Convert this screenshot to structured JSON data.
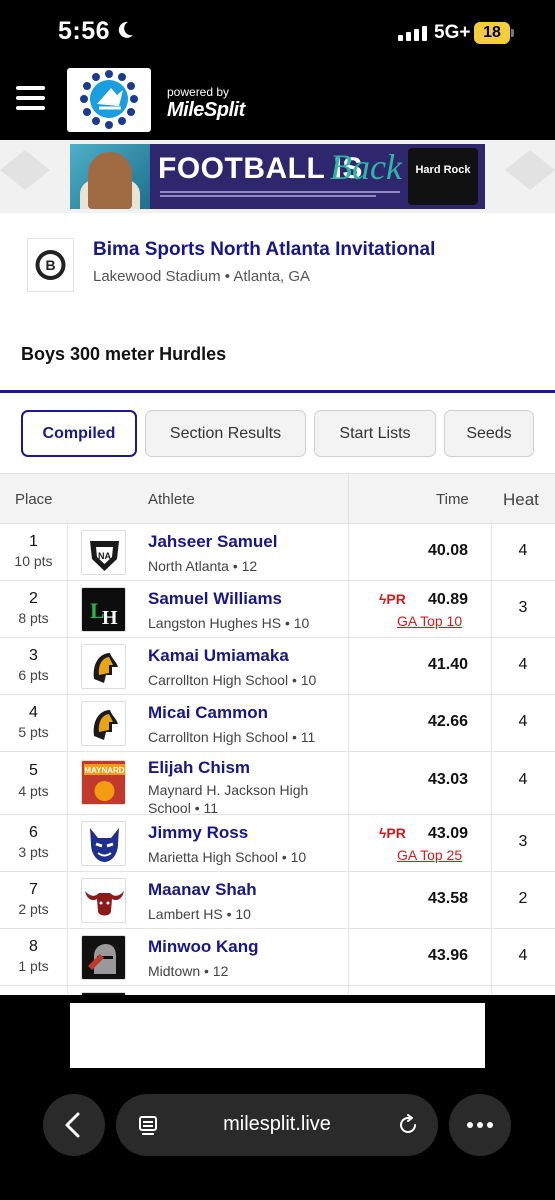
{
  "status_bar": {
    "time": "5:56",
    "network": "5G+",
    "battery": "18"
  },
  "header": {
    "powered_by": "powered by",
    "brand": "MileSplit"
  },
  "ad": {
    "headline_1": "FOOTBALL IS",
    "headline_2": "Back",
    "sponsor": "Hard Rock"
  },
  "meet": {
    "title": "Bima Sports North Atlanta Invitational",
    "location": "Lakewood Stadium • Atlanta, GA"
  },
  "event": {
    "title": "Boys 300 meter Hurdles"
  },
  "tabs": [
    {
      "label": "Compiled",
      "active": true
    },
    {
      "label": "Section Results",
      "active": false
    },
    {
      "label": "Start Lists",
      "active": false
    },
    {
      "label": "Seeds",
      "active": false
    }
  ],
  "table": {
    "headers": {
      "place": "Place",
      "athlete": "Athlete",
      "time": "Time",
      "heat": "Heat"
    },
    "rows": [
      {
        "place": "1",
        "pts": "10 pts",
        "name": "Jahseer Samuel",
        "team": "North Atlanta • 12",
        "time": "40.08",
        "heat": "4",
        "pr": "",
        "badge": "",
        "logo": "warriors-logo-icon"
      },
      {
        "place": "2",
        "pts": "8 pts",
        "name": "Samuel Williams",
        "team": "Langston Hughes HS • 10",
        "time": "40.89",
        "heat": "3",
        "pr": "PR",
        "badge": "GA Top 10",
        "logo": "langston-hughes-logo-icon"
      },
      {
        "place": "3",
        "pts": "6 pts",
        "name": "Kamai Umiamaka",
        "team": "Carrollton High School • 10",
        "time": "41.40",
        "heat": "4",
        "pr": "",
        "badge": "",
        "logo": "trojan-logo-icon"
      },
      {
        "place": "4",
        "pts": "5 pts",
        "name": "Micai Cammon",
        "team": "Carrollton High School • 11",
        "time": "42.66",
        "heat": "4",
        "pr": "",
        "badge": "",
        "logo": "trojan-logo-icon"
      },
      {
        "place": "5",
        "pts": "4 pts",
        "name": "Elijah Chism",
        "team": "Maynard H. Jackson High School • 11",
        "time": "43.03",
        "heat": "4",
        "pr": "",
        "badge": "",
        "logo": "maynard-logo-icon"
      },
      {
        "place": "6",
        "pts": "3 pts",
        "name": "Jimmy Ross",
        "team": "Marietta High School • 10",
        "time": "43.09",
        "heat": "3",
        "pr": "PR",
        "badge": "GA Top 25",
        "logo": "blue-devil-logo-icon"
      },
      {
        "place": "7",
        "pts": "2 pts",
        "name": "Maanav Shah",
        "team": "Lambert HS • 10",
        "time": "43.58",
        "heat": "2",
        "pr": "",
        "badge": "",
        "logo": "longhorn-logo-icon"
      },
      {
        "place": "8",
        "pts": "1 pts",
        "name": "Minwoo Kang",
        "team": "Midtown • 12",
        "time": "43.96",
        "heat": "4",
        "pr": "",
        "badge": "",
        "logo": "knight-logo-icon"
      }
    ]
  },
  "browser": {
    "url": "milesplit.live"
  }
}
